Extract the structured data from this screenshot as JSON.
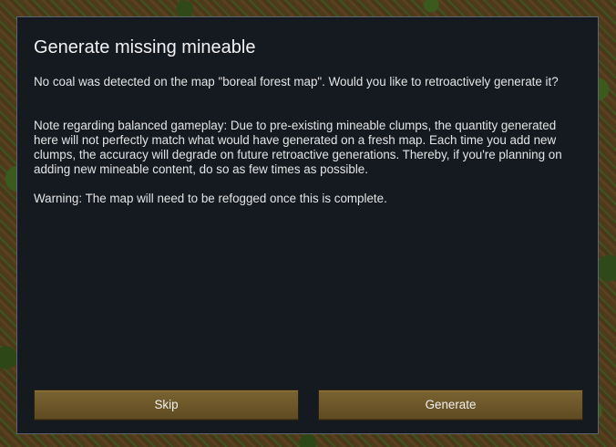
{
  "dialog": {
    "title": "Generate missing mineable",
    "paragraphs": [
      "No coal was detected on the map \"boreal forest map\". Would you like to retroactively generate it?",
      "Note regarding balanced gameplay: Due to pre-existing mineable clumps, the quantity generated here will not perfectly match what would have generated on a fresh map. Each time you add new clumps, the accuracy will degrade on future retroactive generations. Thereby, if you're planning on adding new mineable content, do so as few times as possible.",
      "Warning: The map will need to be refogged once this is complete."
    ],
    "buttons": {
      "skip_label": "Skip",
      "generate_label": "Generate"
    }
  },
  "colors": {
    "dialog_background": "#151a21",
    "dialog_border": "#5e6470",
    "button_fill": "#6b5629",
    "text": "#e4e4e4"
  }
}
